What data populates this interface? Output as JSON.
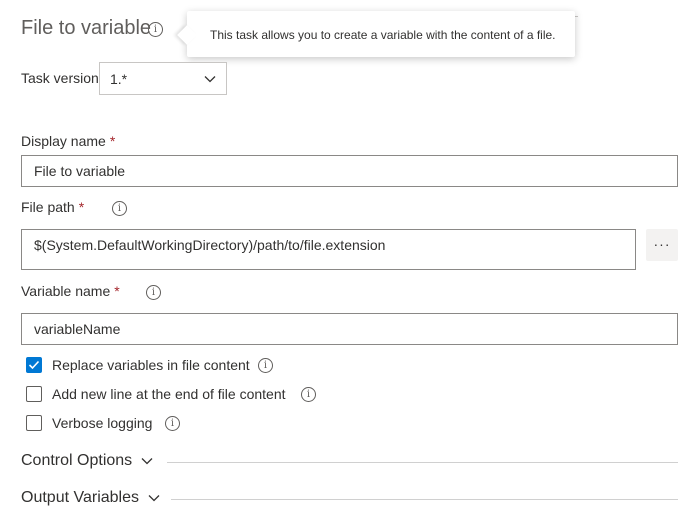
{
  "header": {
    "title": "File to variable",
    "tooltip": "This task allows you to create a variable with the content of a file."
  },
  "task_version": {
    "label": "Task version",
    "value": "1.*"
  },
  "display_name": {
    "label": "Display name",
    "required": "*",
    "value": "File to variable"
  },
  "file_path": {
    "label": "File path",
    "required": "*",
    "value": "$(System.DefaultWorkingDirectory)/path/to/file.extension",
    "browse_label": "···"
  },
  "variable_name": {
    "label": "Variable name",
    "required": "*",
    "value": "variableName"
  },
  "options": [
    {
      "label": "Replace variables in file content",
      "checked": true
    },
    {
      "label": "Add new line at the end of file content",
      "checked": false
    },
    {
      "label": "Verbose logging",
      "checked": false
    }
  ],
  "sections": {
    "control_options": "Control Options",
    "output_variables": "Output Variables"
  },
  "colors": {
    "accent": "#0078d4",
    "required": "#a4262c"
  }
}
